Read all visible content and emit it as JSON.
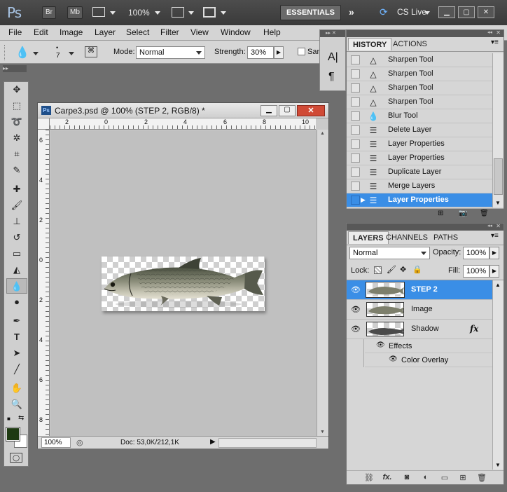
{
  "appbar": {
    "logo": "Ps",
    "bridge": "Br",
    "minibridge": "Mb",
    "zoom": "100%",
    "workspace": "ESSENTIALS",
    "cslive": "CS Live"
  },
  "menu": [
    "File",
    "Edit",
    "Image",
    "Layer",
    "Select",
    "Filter",
    "View",
    "Window",
    "Help"
  ],
  "options": {
    "brush_size": "7",
    "mode_label": "Mode:",
    "mode_value": "Normal",
    "strength_label": "Strength:",
    "strength_value": "30%",
    "sample_label": "Sam"
  },
  "document": {
    "title": "Carpe3.psd @ 100% (STEP 2, RGB/8) *",
    "zoom": "100%",
    "doc_size": "Doc: 53,0K/212,1K",
    "ruler_top": [
      "2",
      "0",
      "2",
      "4",
      "6",
      "8",
      "10"
    ],
    "ruler_left": [
      "6",
      "4",
      "2",
      "0",
      "2",
      "4",
      "6",
      "8"
    ]
  },
  "history": {
    "tabs": [
      "HISTORY",
      "ACTIONS"
    ],
    "items": [
      {
        "icon": "sharpen-icon",
        "label": "Sharpen Tool"
      },
      {
        "icon": "sharpen-icon",
        "label": "Sharpen Tool"
      },
      {
        "icon": "sharpen-icon",
        "label": "Sharpen Tool"
      },
      {
        "icon": "sharpen-icon",
        "label": "Sharpen Tool"
      },
      {
        "icon": "blur-icon",
        "label": "Blur Tool"
      },
      {
        "icon": "history-state-icon",
        "label": "Delete Layer"
      },
      {
        "icon": "history-state-icon",
        "label": "Layer Properties"
      },
      {
        "icon": "history-state-icon",
        "label": "Layer Properties"
      },
      {
        "icon": "history-state-icon",
        "label": "Duplicate Layer"
      },
      {
        "icon": "history-state-icon",
        "label": "Merge Layers"
      },
      {
        "icon": "history-state-icon",
        "label": "Layer Properties"
      }
    ]
  },
  "layers": {
    "tabs": [
      "LAYERS",
      "CHANNELS",
      "PATHS"
    ],
    "blend_mode": "Normal",
    "opacity_label": "Opacity:",
    "opacity_value": "100%",
    "lock_label": "Lock:",
    "fill_label": "Fill:",
    "fill_value": "100%",
    "items": [
      {
        "name": "STEP 2"
      },
      {
        "name": "Image"
      },
      {
        "name": "Shadow"
      }
    ],
    "effects_label": "Effects",
    "effect_name": "Color Overlay",
    "fx_label": "fx"
  },
  "colors": {
    "accent": "#3a8ee6",
    "foreground_swatch": "#1e3a12",
    "background_swatch": "#ffffff"
  }
}
